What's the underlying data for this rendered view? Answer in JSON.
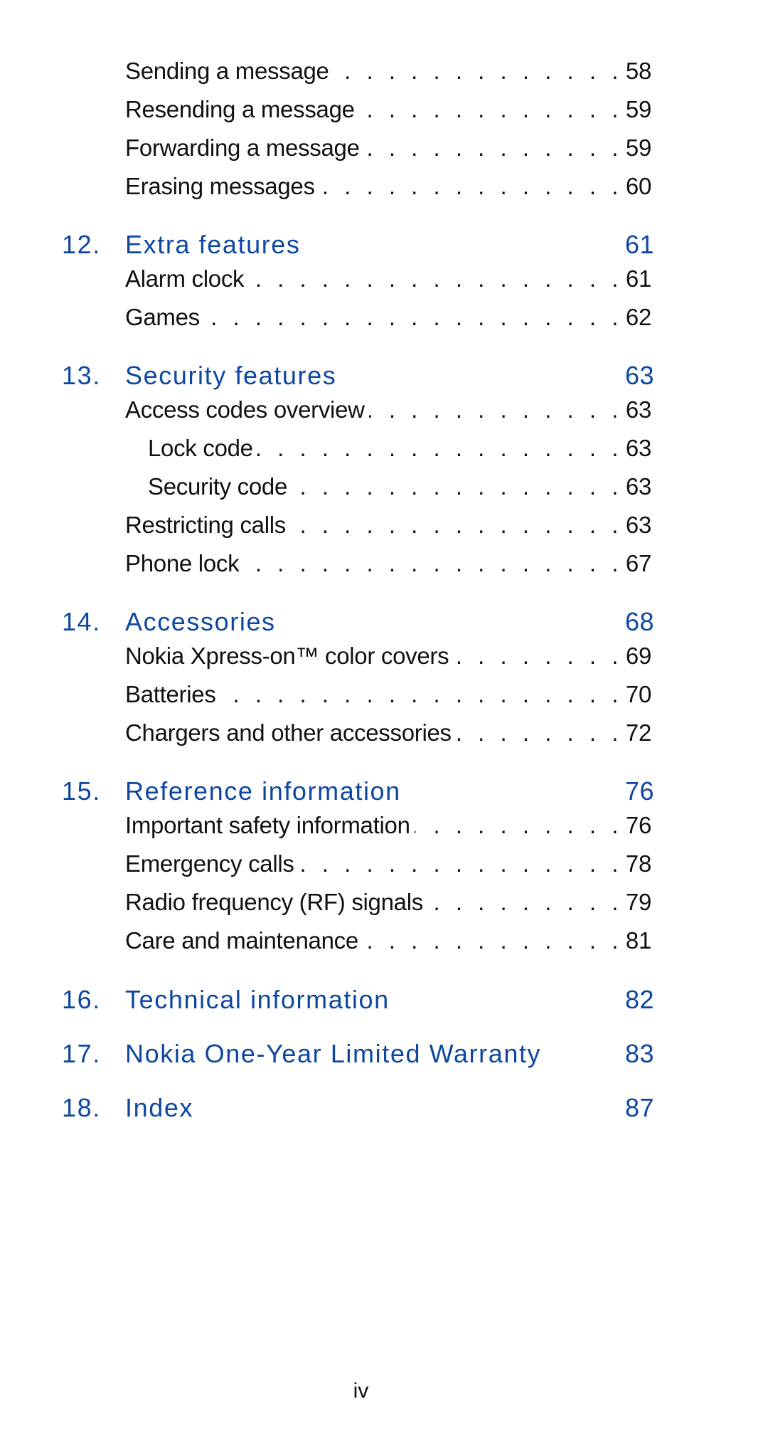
{
  "toc": {
    "entries_top": [
      {
        "label": "Sending a message",
        "page": "58"
      },
      {
        "label": "Resending a message",
        "page": "59"
      },
      {
        "label": "Forwarding a message",
        "page": "59"
      },
      {
        "label": "Erasing messages",
        "page": "60"
      }
    ],
    "chapters": [
      {
        "number": "12.",
        "title": "Extra features",
        "page": "61",
        "entries": [
          {
            "label": "Alarm clock",
            "page": "61"
          },
          {
            "label": "Games",
            "page": "62"
          }
        ]
      },
      {
        "number": "13.",
        "title": "Security features",
        "page": "63",
        "entries": [
          {
            "label": "Access codes overview",
            "page": "63"
          },
          {
            "label": "Lock code",
            "page": "63",
            "sub": true
          },
          {
            "label": "Security code",
            "page": "63",
            "sub": true
          },
          {
            "label": "Restricting calls",
            "page": "63"
          },
          {
            "label": "Phone lock",
            "page": "67"
          }
        ]
      },
      {
        "number": "14.",
        "title": "Accessories",
        "page": "68",
        "entries": [
          {
            "label": "Nokia Xpress-on™ color covers",
            "page": "69"
          },
          {
            "label": "Batteries",
            "page": "70"
          },
          {
            "label": "Chargers and other accessories",
            "page": "72"
          }
        ]
      },
      {
        "number": "15.",
        "title": "Reference information",
        "page": "76",
        "entries": [
          {
            "label": "Important safety information",
            "page": "76"
          },
          {
            "label": "Emergency calls",
            "page": "78"
          },
          {
            "label": "Radio frequency (RF) signals",
            "page": "79"
          },
          {
            "label": "Care and maintenance",
            "page": "81"
          }
        ]
      },
      {
        "number": "16.",
        "title": "Technical information",
        "page": "82",
        "entries": []
      },
      {
        "number": "17.",
        "title": "Nokia One-Year Limited Warranty",
        "page": "83",
        "entries": []
      },
      {
        "number": "18.",
        "title": "Index",
        "page": "87",
        "entries": []
      }
    ],
    "leader_dots": ". . . . . . . . . . . . . . . . . . . . . . . . . . . . . . . . . . . . ."
  },
  "footer": {
    "page_number": "iv"
  },
  "colors": {
    "chapter_heading": "#0d47a1",
    "body_text": "#111111"
  }
}
